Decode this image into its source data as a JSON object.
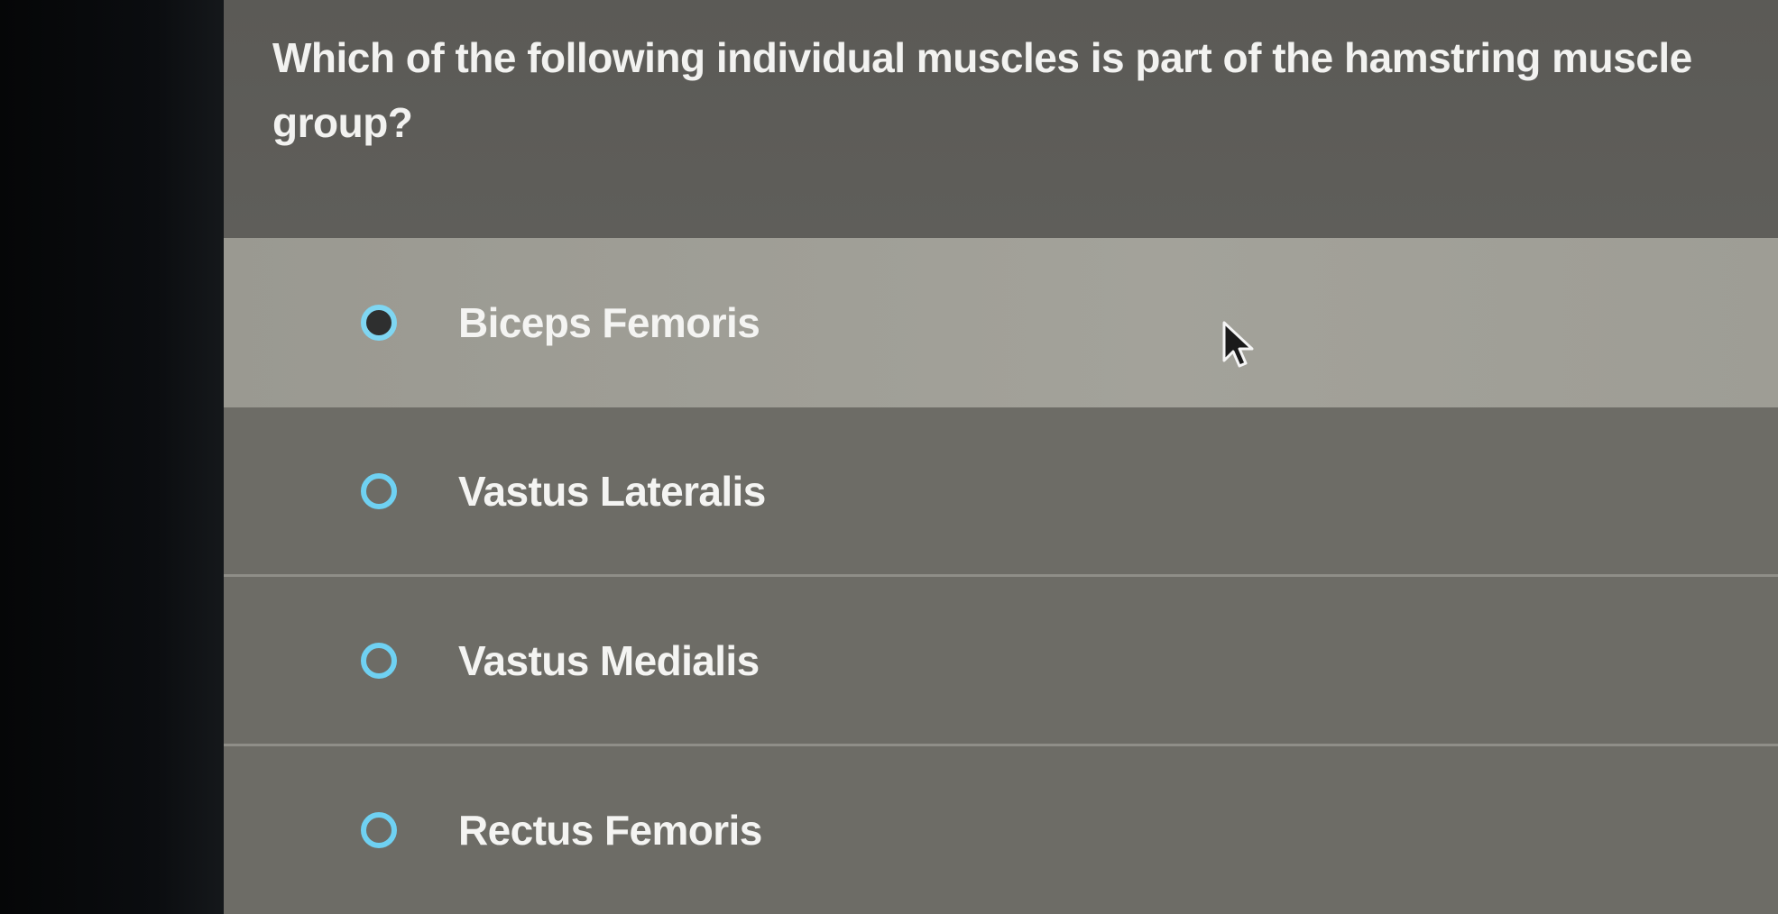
{
  "question": {
    "text": "Which of the following individual muscles is part of the hamstring muscle group?"
  },
  "options": [
    {
      "label": "Biceps Femoris",
      "state": "hovered"
    },
    {
      "label": "Vastus Lateralis",
      "state": "default"
    },
    {
      "label": "Vastus Medialis",
      "state": "default"
    },
    {
      "label": "Rectus Femoris",
      "state": "default"
    }
  ],
  "icons": {
    "radio": "radio-button-icon",
    "cursor": "mouse-pointer-icon"
  },
  "colors": {
    "radio_accent": "#6fd1f2",
    "panel": "#5a5954",
    "hover_row": "#a09f97",
    "text": "#f2f2f0"
  }
}
